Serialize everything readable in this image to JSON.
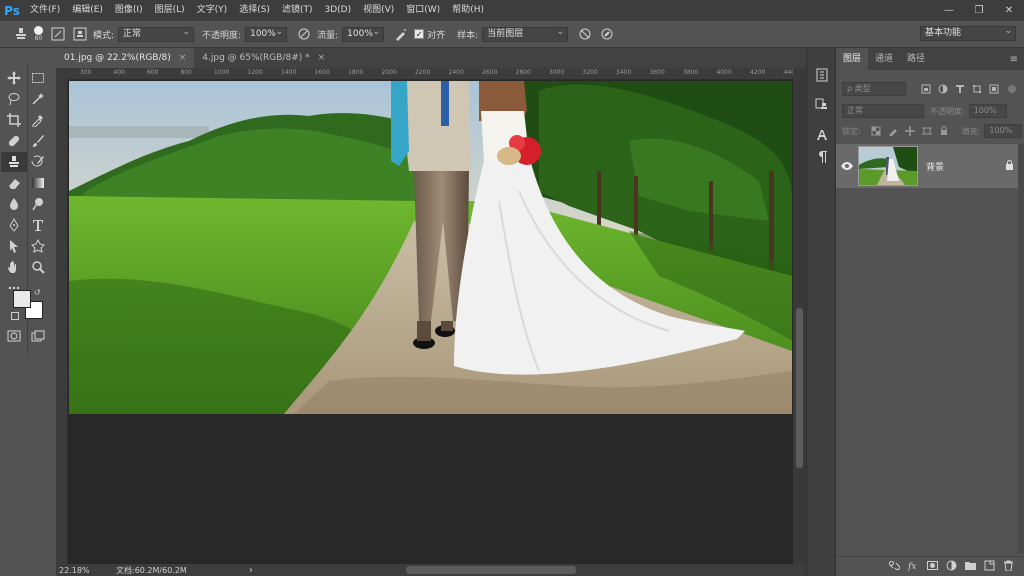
{
  "app": {
    "logo": "Ps",
    "menu": [
      "文件(F)",
      "编辑(E)",
      "图像(I)",
      "图层(L)",
      "文字(Y)",
      "选择(S)",
      "滤镜(T)",
      "3D(D)",
      "视图(V)",
      "窗口(W)",
      "帮助(H)"
    ],
    "window_controls": [
      "—",
      "❐",
      "✕"
    ]
  },
  "options_bar": {
    "brush_size": "80",
    "mode_label": "模式:",
    "mode_value": "正常",
    "opacity_label": "不透明度:",
    "opacity_value": "100%",
    "flow_label": "流量:",
    "flow_value": "100%",
    "aligned_label": "对齐",
    "aligned_checked": "✓",
    "sample_label": "样本:",
    "sample_value": "当前图层",
    "workspace": "基本功能"
  },
  "document": {
    "tabs": [
      {
        "label": "01.jpg @ 22.2%(RGB/8)",
        "close": "×",
        "active": true
      },
      {
        "label": "4.jpg @ 65%(RGB/8#) *",
        "close": "×",
        "active": false
      }
    ],
    "ruler_numbers": [
      "300",
      "400",
      "600",
      "800",
      "1000",
      "1200",
      "1400",
      "1600",
      "1800",
      "2000",
      "2200",
      "2400",
      "2600",
      "2800",
      "3000",
      "3200",
      "3400",
      "3600",
      "3800",
      "4000",
      "4200",
      "440"
    ],
    "zoom": "22.18%",
    "doc_size": "文档:60.2M/60.2M",
    "status_arrow": "›"
  },
  "panel": {
    "tabs": [
      "图层",
      "通道",
      "路径"
    ],
    "menu_icon": "≡",
    "kind_placeholder": "ρ 类型",
    "blend_mode": "正常",
    "opacity_label": "不透明度:",
    "opacity_value": "100%",
    "lock_label": "锁定:",
    "fill_label": "填充:",
    "fill_value": "100%",
    "layer_name": "背景"
  },
  "colors": {
    "accent": "#31a8ff",
    "panel_bg": "#535353",
    "menubar_bg": "#3d3d3d",
    "canvas_bg": "#282828",
    "selected_layer": "#6a6a6a"
  }
}
